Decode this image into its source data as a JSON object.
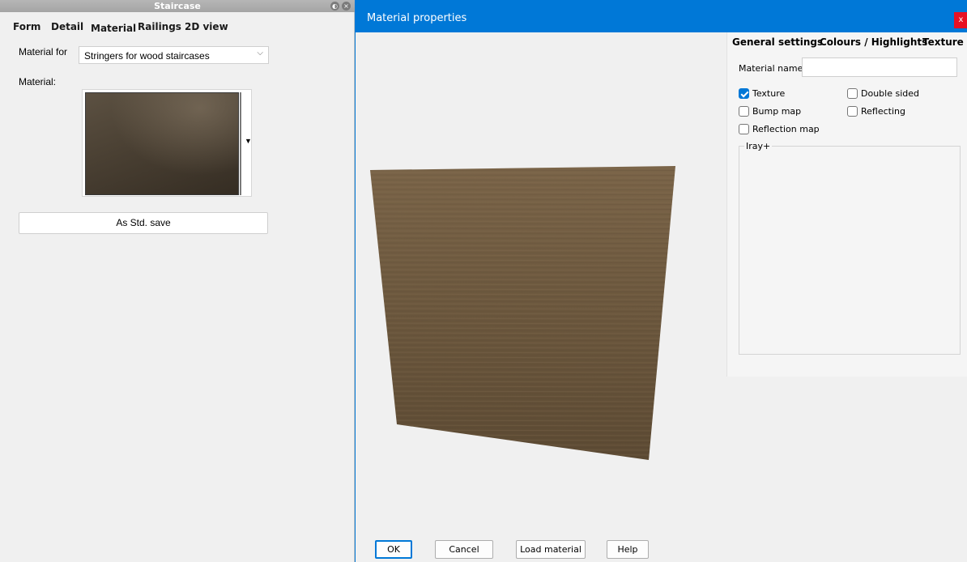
{
  "staircase_panel": {
    "title": "Staircase",
    "tabs": [
      "Form",
      "Detail",
      "Material",
      "Railings",
      "2D view"
    ],
    "active_tab": "Material",
    "material_for_label": "Material for",
    "material_for_value": "Stringers for wood staircases",
    "material_label": "Material:",
    "std_save_label": "As Std. save",
    "swatch_colors": [
      "#5c5142",
      "#4a4033",
      "#352d23"
    ]
  },
  "dialog": {
    "title": "Material properties",
    "close_label": "x",
    "tabs": [
      "General settings",
      "Colours / Highlights",
      "Texture"
    ],
    "active_tab": "General settings",
    "material_name_label": "Material name:",
    "material_name_value": "",
    "checkboxes": [
      {
        "label": "Texture",
        "checked": true
      },
      {
        "label": "Double sided",
        "checked": false
      },
      {
        "label": "Bump map",
        "checked": false
      },
      {
        "label": "Reflecting",
        "checked": false
      },
      {
        "label": "Reflection map",
        "checked": false
      }
    ],
    "group_label": "Iray+",
    "buttons": {
      "ok": "OK",
      "cancel": "Cancel",
      "load_material": "Load material",
      "help": "Help"
    },
    "accent_color": "#0078d7",
    "close_color": "#e81123",
    "preview_colors": [
      "#7a6448",
      "#6b573d",
      "#5c4a33"
    ]
  }
}
